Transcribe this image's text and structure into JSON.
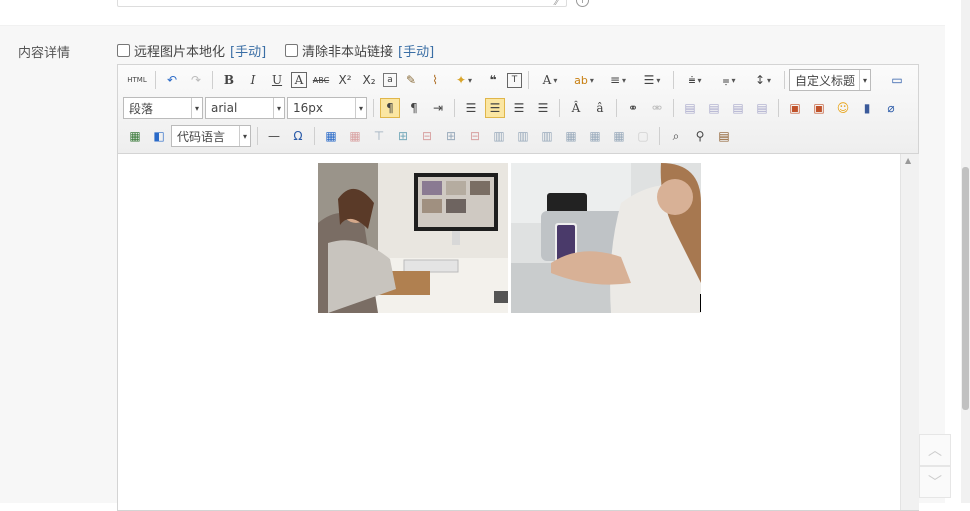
{
  "form": {
    "label": "内容详情",
    "option_remote_images": "远程图片本地化",
    "option_remote_images_link": "[手动]",
    "option_clear_links": "清除非本站链接",
    "option_clear_links_link": "[手动]"
  },
  "toolbar": {
    "html_label": "HTML",
    "paragraph_select": "段落",
    "font_family_select": "arial",
    "font_size_select": "16px",
    "custom_title_select": "自定义标题",
    "code_language_select": "代码语言"
  },
  "colors": {
    "accent_active": "#fbe6a2",
    "link": "#3a6ea5"
  }
}
